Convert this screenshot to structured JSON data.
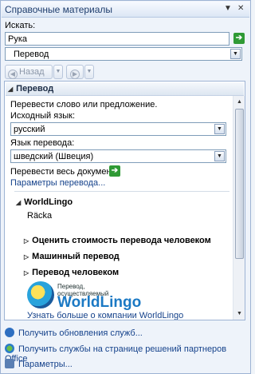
{
  "pane": {
    "title": "Справочные материалы",
    "dropdown_glyph": "▼",
    "close_glyph": "✕"
  },
  "search": {
    "label": "Искать:",
    "value": "Рука"
  },
  "service": {
    "selected": "Перевод"
  },
  "nav": {
    "back_label": "Назад"
  },
  "results": {
    "section_title": "Перевод",
    "intro": "Перевести слово или предложение.",
    "source_label": "Исходный язык:",
    "source_value": "русский",
    "target_label": "Язык перевода:",
    "target_value": "шведский (Швеция)",
    "translate_doc": "Перевести весь документ",
    "options_link": "Параметры перевода...",
    "provider_title": "WorldLingo",
    "translation": "Räcka",
    "items": [
      "Оценить стоимость перевода человеком",
      "Машинный перевод",
      "Перевод человеком"
    ],
    "logo_small_1": "Перевод,",
    "logo_small_2": "осуществляемый",
    "logo_brand": "WorldLingo",
    "about_link": "Узнать больше о компании WorldLingo"
  },
  "footer": {
    "updates": "Получить обновления служб...",
    "partners": "Получить службы на странице решений партнеров Office",
    "params": "Параметры..."
  },
  "colors": {
    "accent": "#15428b",
    "go_green": "#2f9a35",
    "brand_blue": "#1b79c4"
  }
}
